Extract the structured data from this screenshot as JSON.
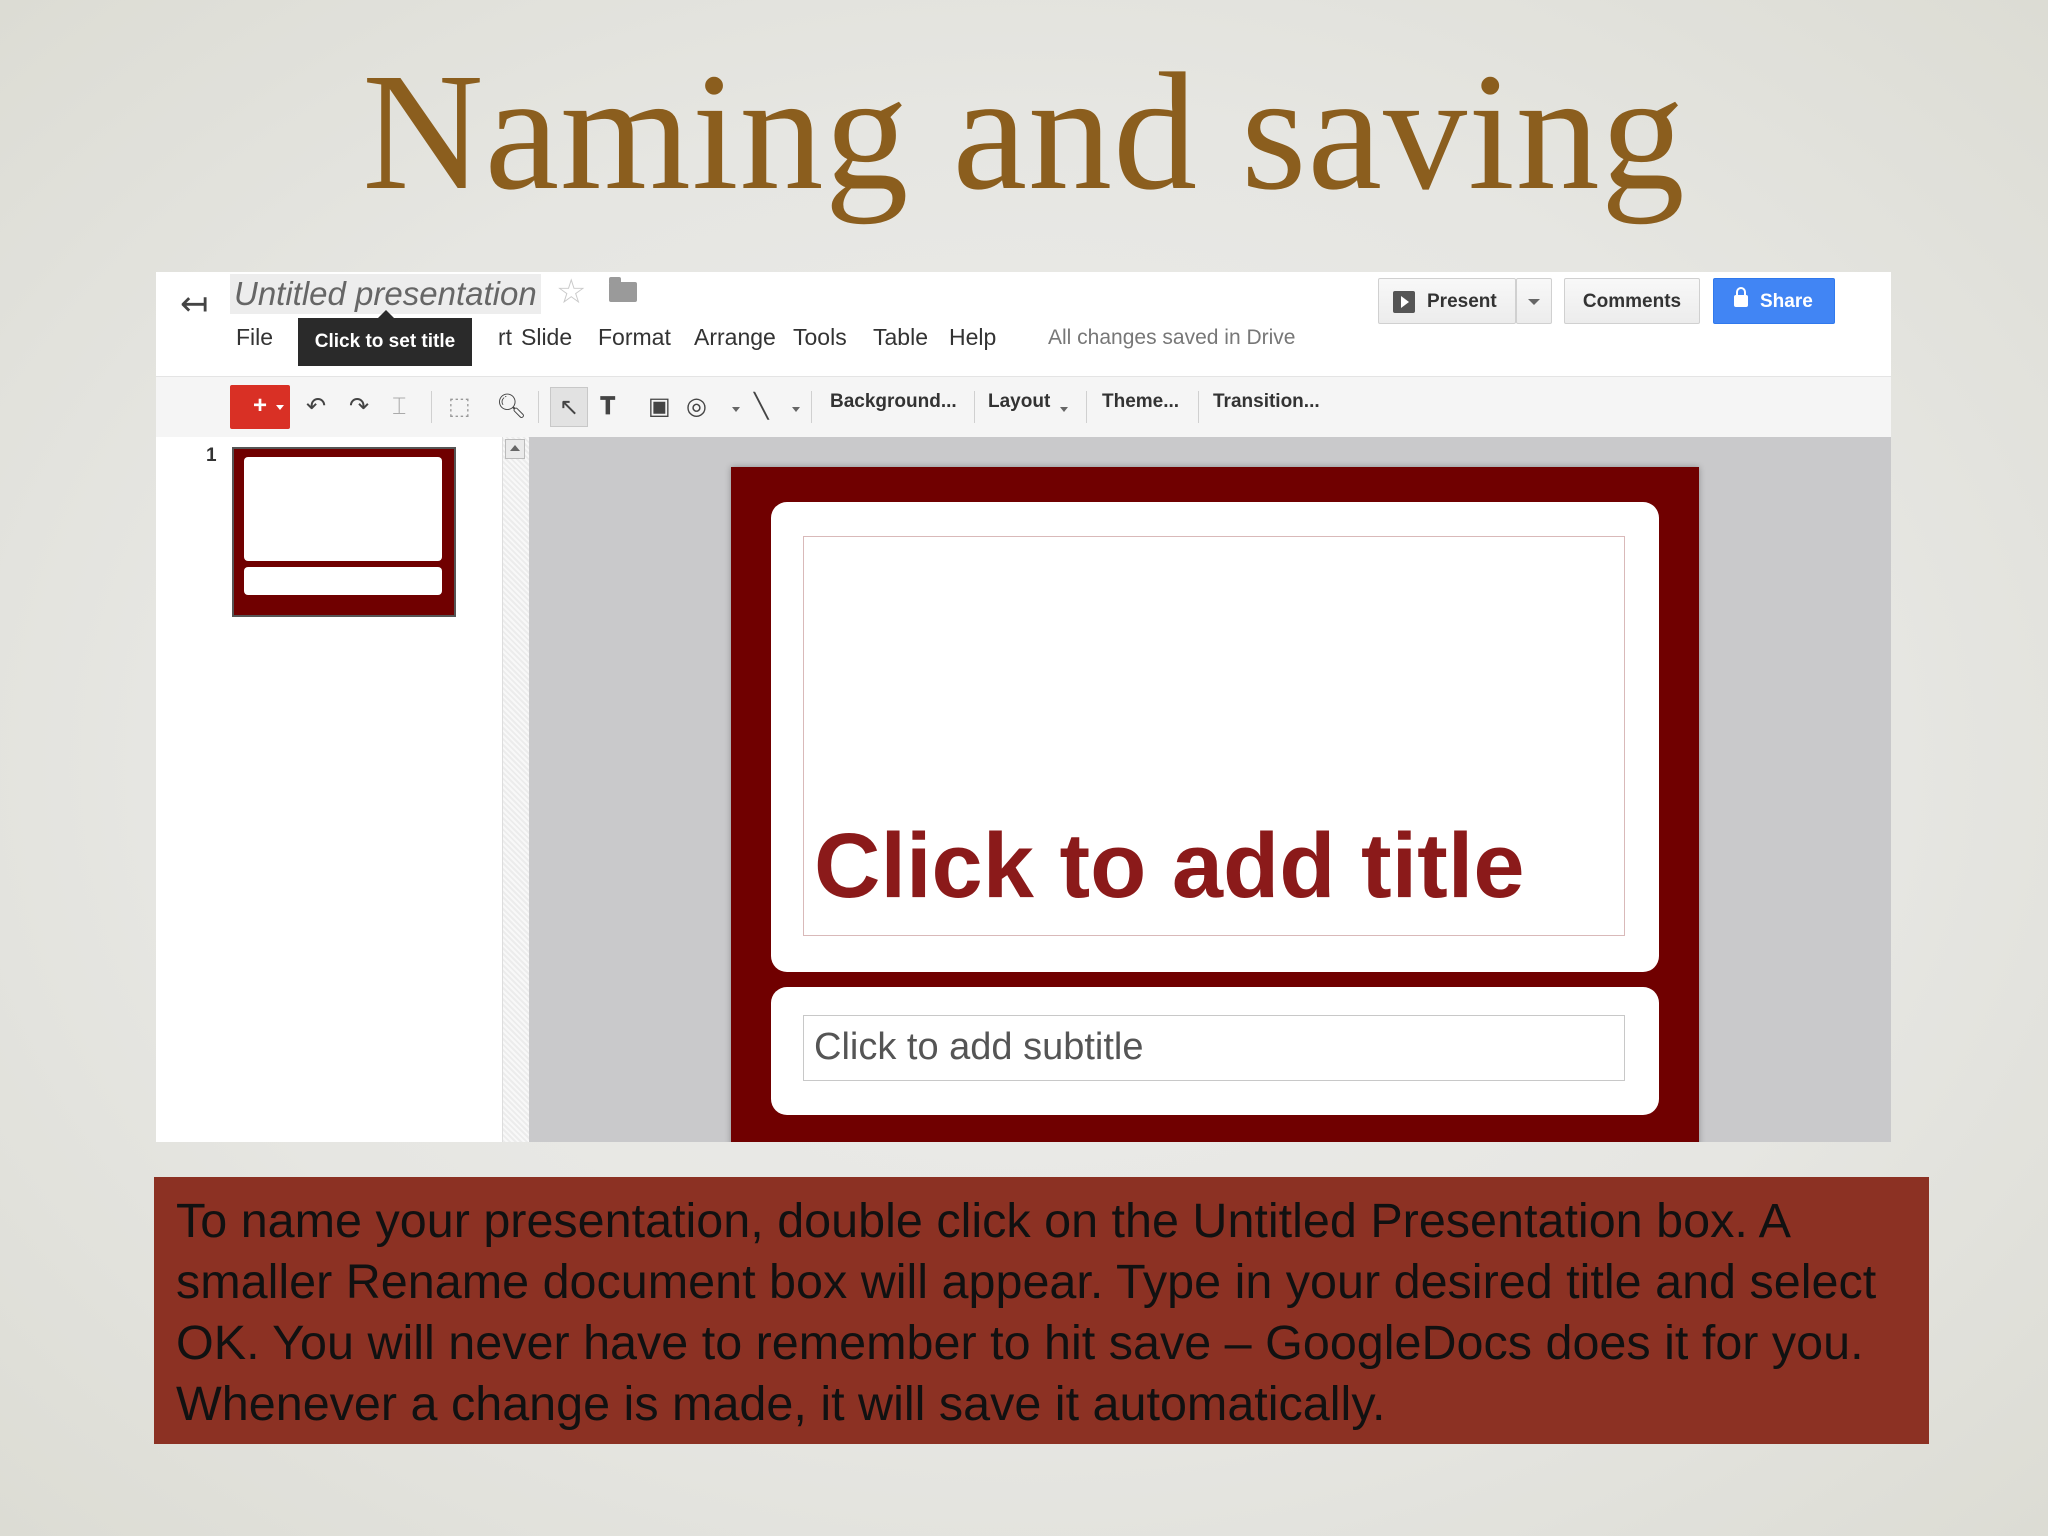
{
  "slide": {
    "title": "Naming and saving",
    "caption": "To name your presentation, double click on the Untitled Presentation box. A smaller Rename document box will appear. Type in your desired title and select OK. You will never have to remember to hit save – GoogleDocs does it for you. Whenever a change is made, it will save it automatically."
  },
  "app": {
    "doc_title": "Untitled presentation",
    "tooltip": "Click to set title",
    "menu": {
      "file": "File",
      "insert_partial": "rt",
      "slide": "Slide",
      "format": "Format",
      "arrange": "Arrange",
      "tools": "Tools",
      "table": "Table",
      "help": "Help"
    },
    "saved_status": "All changes saved in Drive",
    "buttons": {
      "present": "Present",
      "comments": "Comments",
      "share": "Share"
    },
    "toolbar": {
      "new": "+",
      "background": "Background...",
      "layout": "Layout",
      "theme": "Theme...",
      "transition": "Transition..."
    },
    "filmstrip": {
      "slide_number": "1"
    },
    "canvas": {
      "title_placeholder": "Click to add title",
      "subtitle_placeholder": "Click to add subtitle"
    },
    "colors": {
      "slide_theme": "#700000",
      "title_text": "#8b1a1a",
      "share_button": "#4185f4",
      "new_button": "#d93025",
      "caption_background": "#8c3123",
      "slide_title_text": "#8b5e1e"
    }
  }
}
